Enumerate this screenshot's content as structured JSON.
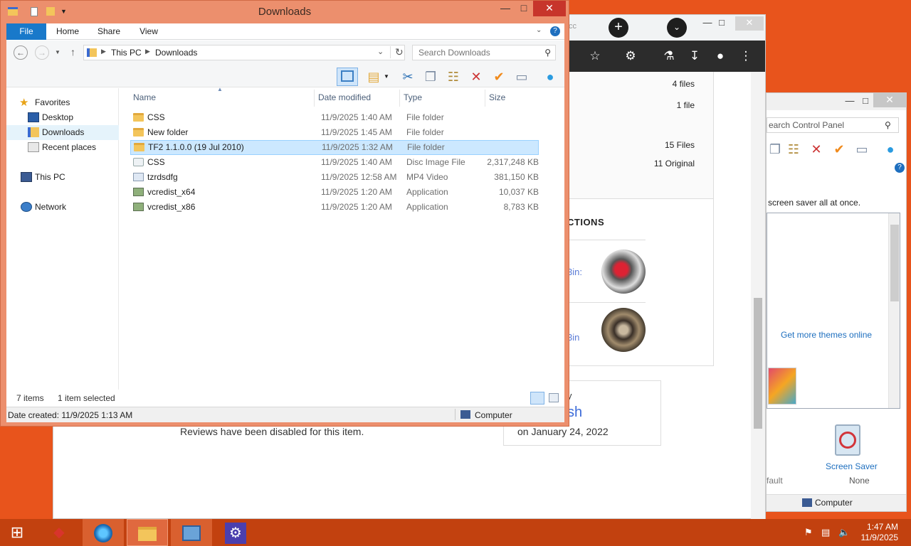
{
  "browser": {
    "tab_partial": "cc",
    "stats": [
      "4 files",
      "1 file",
      "15 Files",
      "11 Original"
    ],
    "collections_heading": "CTIONS",
    "collection_links": [
      "3in:",
      "3in"
    ],
    "reviews_text": "Reviews have been disabled for this item.",
    "by_text": "y",
    "author_partial": "sh",
    "date_text": "on January 24, 2022"
  },
  "cpanel": {
    "search_placeholder": "earch Control Panel",
    "hint": "screen saver all at once.",
    "more_themes": "Get more themes online",
    "screen_saver_label": "Screen Saver",
    "screen_saver_value": "None",
    "fault_text": "fault",
    "status_text": "Computer"
  },
  "explorer": {
    "title": "Downloads",
    "ribbon_tabs": [
      "File",
      "Home",
      "Share",
      "View"
    ],
    "breadcrumb": [
      "This PC",
      "Downloads"
    ],
    "search_placeholder": "Search Downloads",
    "nav": {
      "favorites": "Favorites",
      "desktop": "Desktop",
      "downloads": "Downloads",
      "recent": "Recent places",
      "this_pc": "This PC",
      "network": "Network"
    },
    "columns": [
      "Name",
      "Date modified",
      "Type",
      "Size"
    ],
    "files": [
      {
        "name": "CSS",
        "date": "11/9/2025 1:40 AM",
        "type": "File folder",
        "size": "",
        "icon": "folder-icon"
      },
      {
        "name": "New folder",
        "date": "11/9/2025 1:45 AM",
        "type": "File folder",
        "size": "",
        "icon": "folder-icon"
      },
      {
        "name": "TF2 1.1.0.0 (19 Jul 2010)",
        "date": "11/9/2025 1:32 AM",
        "type": "File folder",
        "size": "",
        "icon": "folder-icon"
      },
      {
        "name": "CSS",
        "date": "11/9/2025 1:40 AM",
        "type": "Disc Image File",
        "size": "2,317,248 KB",
        "icon": "disc-image-icon"
      },
      {
        "name": "tzrdsdfg",
        "date": "11/9/2025 12:58 AM",
        "type": "MP4 Video",
        "size": "381,150 KB",
        "icon": "video-file-icon"
      },
      {
        "name": "vcredist_x64",
        "date": "11/9/2025 1:20 AM",
        "type": "Application",
        "size": "10,037 KB",
        "icon": "application-icon"
      },
      {
        "name": "vcredist_x86",
        "date": "11/9/2025 1:20 AM",
        "type": "Application",
        "size": "8,783 KB",
        "icon": "application-icon"
      }
    ],
    "item_count": "7 items",
    "selection": "1 item selected",
    "date_created": "Date created: 11/9/2025 1:13 AM",
    "location": "Computer"
  },
  "taskbar": {
    "time": "1:47 AM",
    "date": "11/9/2025"
  }
}
